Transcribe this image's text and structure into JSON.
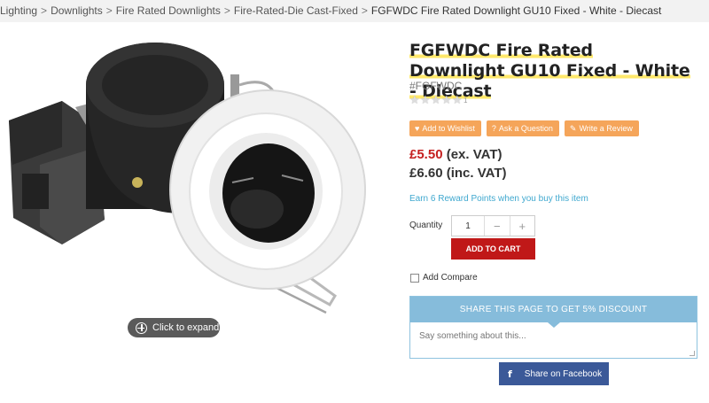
{
  "breadcrumb": {
    "items": [
      "Lighting",
      "Downlights",
      "Fire Rated Downlights",
      "Fire-Rated-Die Cast-Fixed"
    ],
    "current": "FGFWDC Fire Rated Downlight GU10 Fixed - White - Diecast",
    "separator": ">"
  },
  "product": {
    "title": "FGFWDC Fire Rated Downlight GU10 Fixed - White - Diecast",
    "sku": "#FGFWDC",
    "rating": {
      "stars": 0,
      "max": 5,
      "count": "1"
    },
    "expand_label": "Click to expand"
  },
  "actions": {
    "wishlist": "Add to Wishlist",
    "question": "Ask a Question",
    "review": "Write a Review"
  },
  "pricing": {
    "ex_vat_amount": "£5.50",
    "ex_vat_label": "(ex. VAT)",
    "inc_vat": "£6.60 (inc. VAT)"
  },
  "rewards_text": "Earn 6 Reward Points when you buy this item",
  "cart": {
    "quantity_label": "Quantity",
    "quantity_value": "1",
    "minus": "−",
    "plus": "+",
    "add_to_cart": "ADD TO CART"
  },
  "compare_label": "Add Compare",
  "share": {
    "heading": "SHARE THIS PAGE TO GET 5% DISCOUNT",
    "placeholder": "Say something about this...",
    "facebook_label": "Share on Facebook",
    "facebook_icon": "f"
  },
  "colors": {
    "accent_orange": "#f5a55a",
    "price_red": "#c51f1f",
    "cart_red": "#c01818",
    "share_blue": "#86bcdb",
    "facebook_blue": "#3b5998",
    "rewards_blue": "#3fa8cf"
  },
  "icons": {
    "wishlist": "heart-icon",
    "question": "question-circle-icon",
    "review": "edit-icon",
    "expand": "plus-circle-icon",
    "facebook": "facebook-icon"
  }
}
